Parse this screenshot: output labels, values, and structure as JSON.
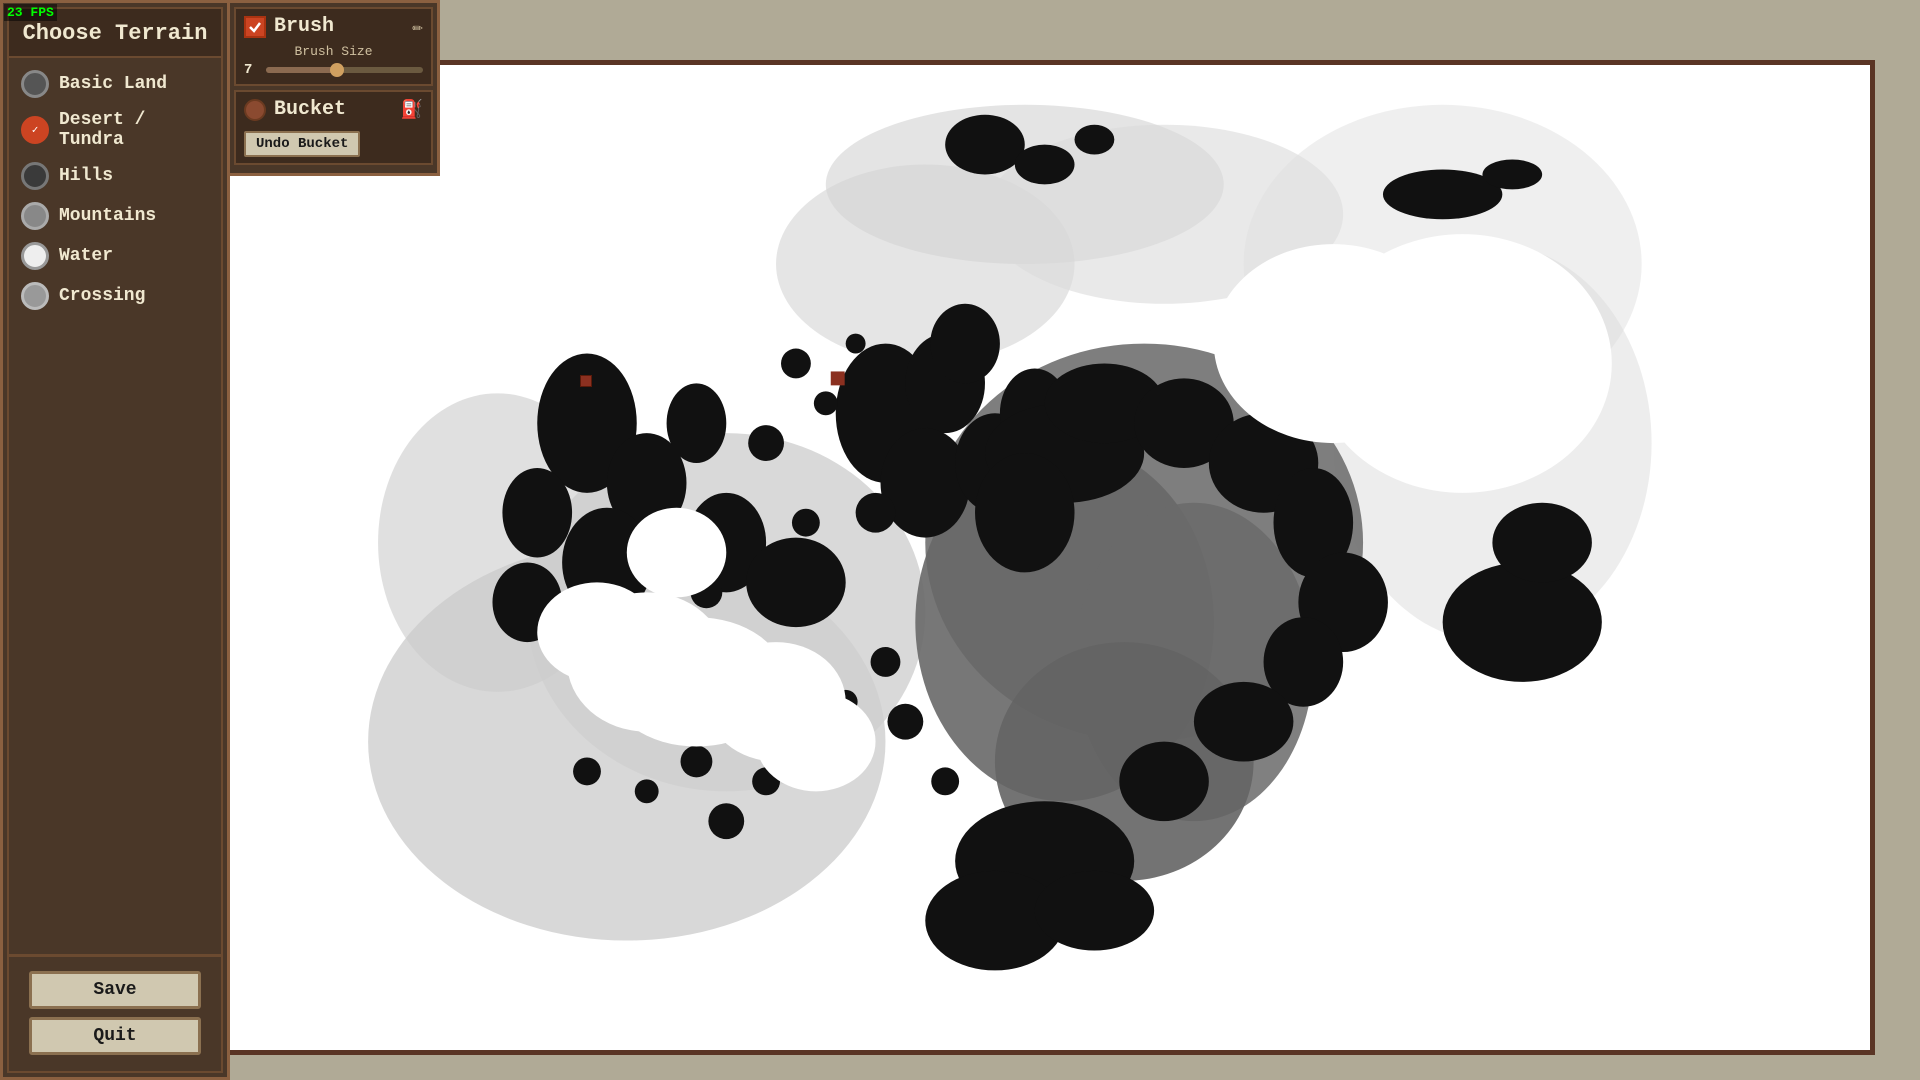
{
  "fps": "23 FPS",
  "title": "Choose Terrain",
  "terrain_items": [
    {
      "id": "basic-land",
      "label": "Basic Land",
      "color": "#555555",
      "selected": false
    },
    {
      "id": "desert-tundra",
      "label": "Desert / Tundra",
      "color": "#cc4422",
      "selected": true
    },
    {
      "id": "hills",
      "label": "Hills",
      "color": "#3a3a3a",
      "selected": false
    },
    {
      "id": "mountains",
      "label": "Mountains",
      "color": "#888888",
      "selected": false
    },
    {
      "id": "water",
      "label": "Water",
      "color": "#eeeeee",
      "selected": false
    },
    {
      "id": "crossing",
      "label": "Crossing",
      "color": "#999999",
      "selected": false
    }
  ],
  "tools": {
    "brush": {
      "name": "Brush",
      "active": true,
      "brush_size_label": "Brush Size",
      "brush_size_value": "7",
      "slider_percent": 45
    },
    "bucket": {
      "name": "Bucket",
      "active": false,
      "undo_label": "Undo Bucket"
    }
  },
  "buttons": {
    "save": "Save",
    "quit": "Quit"
  }
}
